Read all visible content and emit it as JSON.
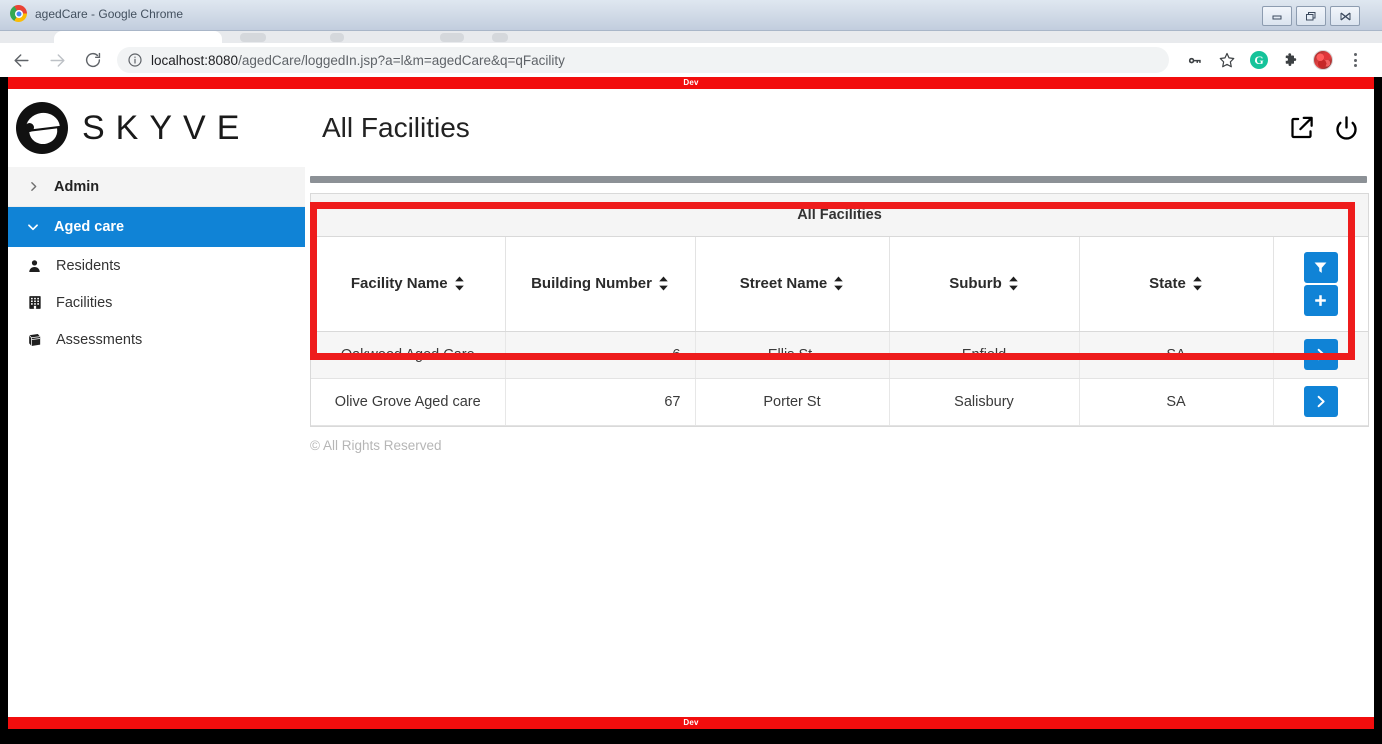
{
  "browser": {
    "window_title": "agedCare - Google Chrome",
    "url_host": "localhost:8080",
    "url_path": "/agedCare/loggedIn.jsp?a=l&m=agedCare&q=qFacility",
    "back_icon": "back-arrow-icon",
    "forward_icon": "forward-arrow-icon",
    "reload_icon": "reload-icon",
    "info_icon": "site-info-icon",
    "password_icon": "key-icon",
    "bookmark_icon": "star-icon",
    "grammarly_label": "G",
    "extensions_icon": "puzzle-piece-icon",
    "profile_icon": "profile-avatar-icon",
    "menu_icon": "three-dots-menu-icon",
    "minimize_label": "Minimize",
    "restore_label": "Restore",
    "close_label": "Close"
  },
  "env_banner": {
    "label": "Dev",
    "color": "#f20d0d"
  },
  "header": {
    "brand": "SKYVE",
    "brand_mark": "skyve-logo-icon",
    "page_title": "All Facilities",
    "share_icon": "share-export-icon",
    "logout_icon": "power-logout-icon"
  },
  "sidebar": {
    "groups": [
      {
        "label": "Admin",
        "state": "collapsed",
        "chevron": "chevron-right-icon"
      },
      {
        "label": "Aged care",
        "state": "expanded",
        "chevron": "chevron-down-icon"
      }
    ],
    "items": [
      {
        "label": "Residents",
        "icon": "person-icon"
      },
      {
        "label": "Facilities",
        "icon": "building-icon"
      },
      {
        "label": "Assessments",
        "icon": "book-icon"
      }
    ]
  },
  "grid": {
    "caption": "All Facilities",
    "columns": [
      {
        "label": "Facility Name",
        "sortable": true,
        "sort_icon": "sort-updown-icon"
      },
      {
        "label": "Building Number",
        "sortable": true,
        "sort_icon": "sort-updown-icon"
      },
      {
        "label": "Street Name",
        "sortable": true,
        "sort_icon": "sort-updown-icon"
      },
      {
        "label": "Suburb",
        "sortable": true,
        "sort_icon": "sort-updown-icon"
      },
      {
        "label": "State",
        "sortable": true,
        "sort_icon": "sort-updown-icon"
      }
    ],
    "toolbar": {
      "filter_icon": "funnel-filter-icon",
      "add_icon": "plus-add-icon"
    },
    "row_action_icon": "chevron-right-icon",
    "rows": [
      {
        "facility_name": "Oakwood Aged Care",
        "building_number": "6",
        "street_name": "Ellis St.",
        "suburb": "Enfield",
        "state": "SA"
      },
      {
        "facility_name": "Olive Grove Aged care",
        "building_number": "67",
        "street_name": "Porter St",
        "suburb": "Salisbury",
        "state": "SA"
      }
    ]
  },
  "footer": {
    "copyright": "© All Rights Reserved"
  },
  "colors": {
    "accent": "#1083d6",
    "annotation": "#ee1c1c",
    "dev_banner": "#f20d0d"
  }
}
